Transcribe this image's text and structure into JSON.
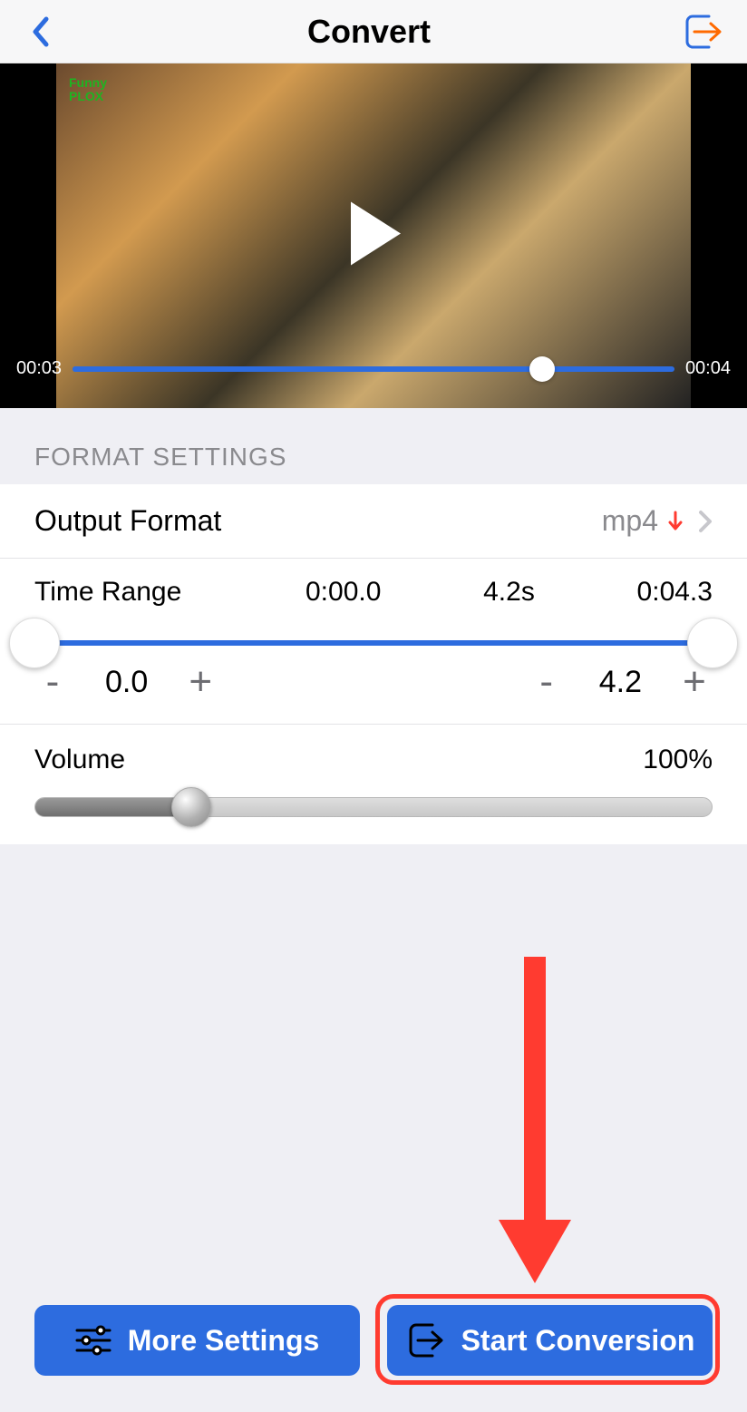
{
  "header": {
    "title": "Convert"
  },
  "video": {
    "current_time": "00:03",
    "total_time": "00:04",
    "watermark_line1": "Funny",
    "watermark_line2": "PLOX"
  },
  "format_section_label": "FORMAT SETTINGS",
  "output": {
    "label": "Output Format",
    "value": "mp4"
  },
  "timerange": {
    "label": "Time Range",
    "start": "0:00.0",
    "duration": "4.2s",
    "end": "0:04.3",
    "start_val": "0.0",
    "end_val": "4.2"
  },
  "volume": {
    "label": "Volume",
    "value": "100%"
  },
  "footer": {
    "more": "More Settings",
    "start": "Start Conversion"
  }
}
